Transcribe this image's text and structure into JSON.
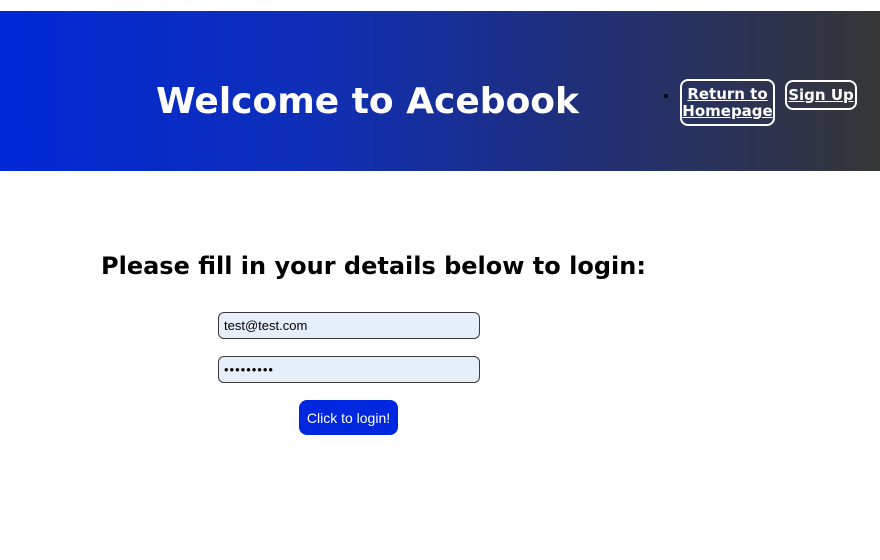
{
  "header": {
    "title": "Welcome to Acebook",
    "nav": {
      "home_label": "Return to Homepage",
      "signup_label": "Sign Up"
    }
  },
  "main": {
    "prompt": "Please fill in your details below to login:",
    "email": {
      "value": "test@test.com"
    },
    "password": {
      "value": "password1"
    },
    "submit_label": "Click to login!"
  },
  "colors": {
    "header_gradient_start": "#0027d6",
    "header_gradient_end": "#363636",
    "button_primary": "#0027e0",
    "input_background": "#e6eefa"
  }
}
